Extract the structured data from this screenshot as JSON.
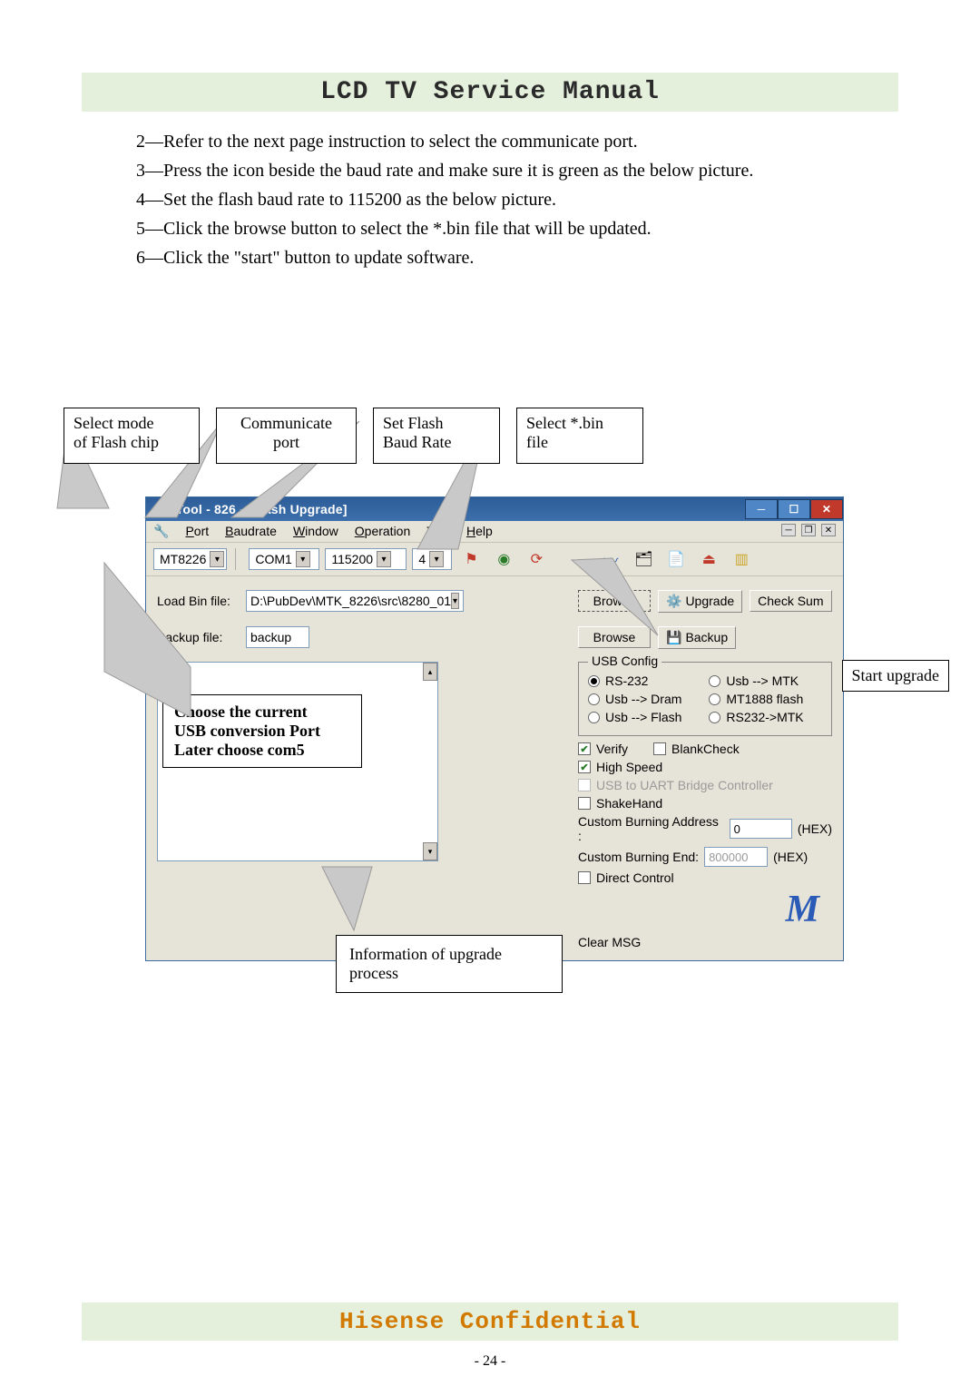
{
  "header": {
    "title": "LCD TV Service Manual"
  },
  "instructions": {
    "i2": "2—Refer to the next page instruction to select the communicate port.",
    "i3": "3—Press the icon beside the baud rate and make sure it is green as the below picture.",
    "i4": "4—Set the flash baud rate to 115200 as the below picture.",
    "i5": "5—Click the browse button to select the *.bin file that will be updated.",
    "i6": "6—Click the \"start\" button to update software."
  },
  "callouts": {
    "c1_l1": "Select  mode",
    "c1_l2": "of Flash chip",
    "c2_l1": "Communicate",
    "c2_l2": "port",
    "c3_l1": "Set    Flash",
    "c3_l2": "Baud Rate",
    "c4_l1": "Select  *.bin",
    "c4_l2": "file",
    "usb_l1": "Choose  the  current",
    "usb_l2": "USB conversion Port",
    "usb_l3": "Later choose com5",
    "start": "Start upgrade",
    "info_l1": "Information    of    upgrade",
    "info_l2": "process"
  },
  "window": {
    "title": "MtkTool - 826 - [Flash Upgrade]",
    "menus": {
      "port": "Port",
      "baud": "Baudrate",
      "window": "Window",
      "operation": "Operation",
      "tool": "Tool",
      "help": "Help"
    },
    "toolbar": {
      "chip_model": "MT8226",
      "com": "COM1",
      "baud": "115200",
      "extra": "4"
    },
    "form": {
      "load_label": "Load Bin file:",
      "load_value": "D:\\PubDev\\MTK_8226\\src\\8280_01",
      "backup_label": "Backup file:",
      "backup_value": "backup",
      "browse": "Browse",
      "upgrade": "Upgrade",
      "checksum": "Check Sum",
      "backup_btn": "Backup",
      "clear_msg": "Clear MSG"
    },
    "usb_config": {
      "legend": "USB Config",
      "rs232": "RS-232",
      "usb_mtk": "Usb --> MTK",
      "usb_dram": "Usb --> Dram",
      "mt1888": "MT1888 flash",
      "usb_flash": "Usb --> Flash",
      "rs232_mtk": "RS232->MTK"
    },
    "options": {
      "verify": "Verify",
      "blank": "BlankCheck",
      "highspeed": "High Speed",
      "usb_uart": "USB to UART Bridge Controller",
      "shakehand": "ShakeHand",
      "addr_label": "Custom Burning  Address :",
      "addr_val": "0",
      "end_label": "Custom Burning  End:",
      "end_val": "800000",
      "hex": "(HEX)",
      "direct": "Direct Control"
    }
  },
  "footer": {
    "text": "Hisense Confidential",
    "page": "- 24 -"
  }
}
